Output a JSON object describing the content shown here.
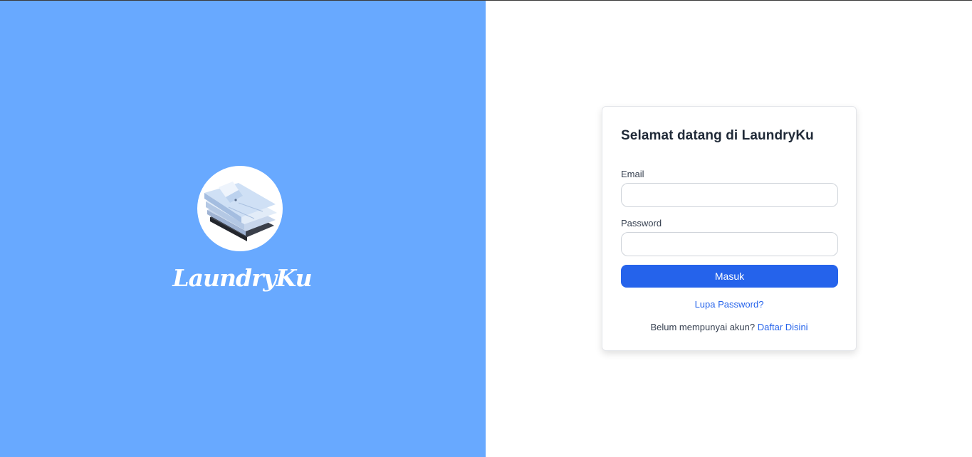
{
  "brand": {
    "name": "LaundryKu",
    "logo_icon": "folded-shirts-icon"
  },
  "login": {
    "title": "Selamat datang di LaundryKu",
    "email_label": "Email",
    "email_value": "",
    "password_label": "Password",
    "password_value": "",
    "submit_label": "Masuk",
    "forgot_label": "Lupa Password?",
    "register_prompt": "Belum mempunyai akun?",
    "register_link": "Daftar Disini"
  },
  "colors": {
    "left_panel": "#68a9ff",
    "primary": "#2563eb",
    "text": "#1f2937"
  }
}
